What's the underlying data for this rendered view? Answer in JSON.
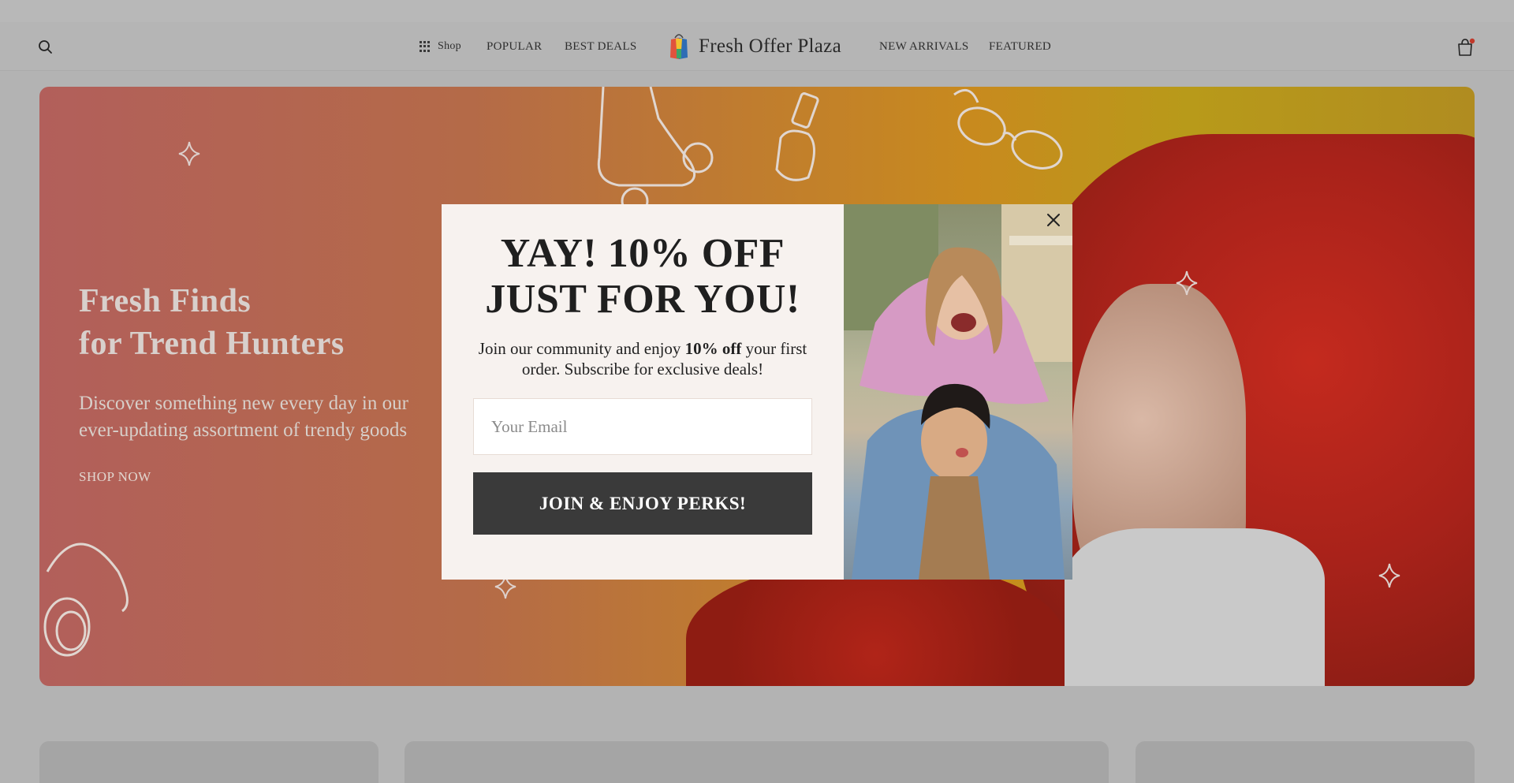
{
  "header": {
    "nav_shop": "Shop",
    "nav_popular": "POPULAR",
    "nav_best_deals": "BEST DEALS",
    "brand": "Fresh Offer Plaza",
    "nav_new_arrivals": "NEW ARRIVALS",
    "nav_featured": "FEATURED",
    "cart_badge_color": "#c0392b"
  },
  "hero": {
    "title_line1": "Fresh Finds",
    "title_line2": "for Trend Hunters",
    "subtitle_line1": "Discover something new every day in our",
    "subtitle_line2": "ever-updating assortment of trendy goods",
    "cta": "SHOP NOW"
  },
  "modal": {
    "title_line1": "YAY! 10% OFF",
    "title_line2": "JUST FOR YOU!",
    "text_before": "Join our community and enjoy ",
    "text_bold": "10% off",
    "text_after": " your first order. Subscribe for exclusive deals!",
    "email_placeholder": "Your Email",
    "button_label": "JOIN & ENJOY PERKS!"
  },
  "colors": {
    "button_bg": "#3a3a3a",
    "modal_bg": "#f7f2ef"
  }
}
